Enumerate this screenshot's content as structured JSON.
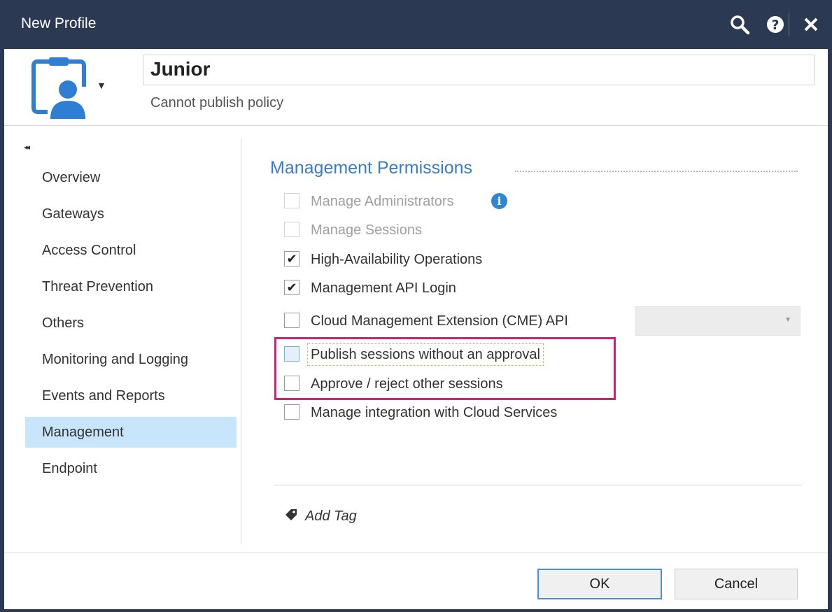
{
  "window": {
    "title": "New Profile"
  },
  "titlebar_icons": [
    "search-icon",
    "help-icon",
    "close-icon"
  ],
  "profile": {
    "name": "Junior",
    "description": "Cannot publish policy",
    "icon": "profile-user-icon"
  },
  "sidebar": {
    "collapse_glyph": "◂◂",
    "items": [
      {
        "label": "Overview",
        "active": false
      },
      {
        "label": "Gateways",
        "active": false
      },
      {
        "label": "Access Control",
        "active": false
      },
      {
        "label": "Threat Prevention",
        "active": false
      },
      {
        "label": "Others",
        "active": false
      },
      {
        "label": "Monitoring and Logging",
        "active": false
      },
      {
        "label": "Events and Reports",
        "active": false
      },
      {
        "label": "Management",
        "active": true
      },
      {
        "label": "Endpoint",
        "active": false
      }
    ]
  },
  "main": {
    "section_title": "Management Permissions",
    "permissions": [
      {
        "label": "Manage Administrators",
        "checked": false,
        "disabled": true,
        "info": true
      },
      {
        "label": "Manage Sessions",
        "checked": false,
        "disabled": true
      },
      {
        "label": "High-Availability Operations",
        "checked": true,
        "disabled": false
      },
      {
        "label": "Management API Login",
        "checked": true,
        "disabled": false
      },
      {
        "label": "Cloud Management Extension (CME) API",
        "checked": false,
        "disabled": false,
        "dropdown_value": ""
      },
      {
        "label": "Publish sessions without an approval",
        "checked": false,
        "disabled": false,
        "focused": true
      },
      {
        "label": "Approve / reject other sessions",
        "checked": false,
        "disabled": false
      },
      {
        "label": "Manage integration with Cloud Services",
        "checked": false,
        "disabled": false
      }
    ],
    "add_tag": "Add Tag"
  },
  "footer": {
    "ok_label": "OK",
    "cancel_label": "Cancel"
  },
  "colors": {
    "titlebar": "#2b3a52",
    "accent": "#3b7cc4",
    "active_nav": "#c7e6fb",
    "highlight": "#cc2277"
  }
}
